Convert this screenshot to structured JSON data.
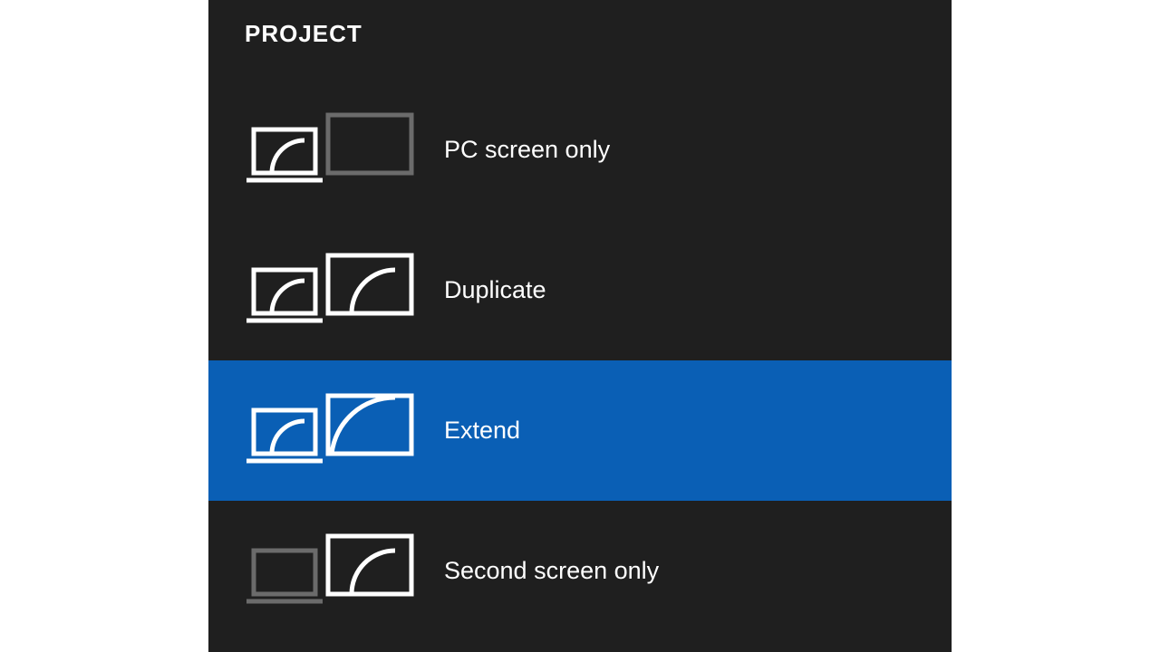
{
  "panel": {
    "title": "PROJECT",
    "options": [
      {
        "id": "pc-screen-only",
        "label": "PC screen only",
        "selected": false
      },
      {
        "id": "duplicate",
        "label": "Duplicate",
        "selected": false
      },
      {
        "id": "extend",
        "label": "Extend",
        "selected": true
      },
      {
        "id": "second-screen-only",
        "label": "Second screen only",
        "selected": false
      }
    ],
    "colors": {
      "background": "#1f1f1f",
      "selected": "#0a5fb5",
      "active_stroke": "#ffffff",
      "inactive_stroke": "#6b6b6b"
    }
  }
}
